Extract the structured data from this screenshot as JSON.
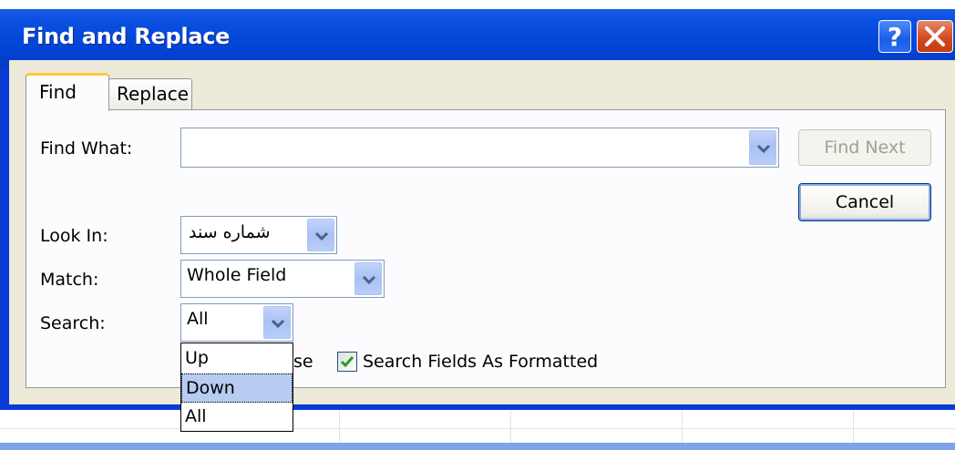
{
  "window": {
    "title": "Find and Replace",
    "help_glyph": "?"
  },
  "tabs": [
    {
      "label": "Find"
    },
    {
      "label": "Replace"
    }
  ],
  "find_what": {
    "label": "Find What:",
    "value": ""
  },
  "look_in": {
    "label": "Look In:",
    "value": "شماره سند"
  },
  "match": {
    "label": "Match:",
    "value": "Whole Field"
  },
  "search": {
    "label": "Search:",
    "value": "All",
    "options": [
      "Up",
      "Down",
      "All"
    ],
    "highlighted": "Down"
  },
  "buttons": {
    "find_next": "Find Next",
    "cancel": "Cancel"
  },
  "checkboxes": {
    "match_case_partial": "se",
    "search_formatted": {
      "label": "Search Fields As Formatted",
      "checked": true
    }
  },
  "colors": {
    "title_bar": "#0a4fe0",
    "dialog_face": "#ece9d8",
    "tab_accent": "#ffc83c",
    "highlight": "#b8cbf0"
  }
}
